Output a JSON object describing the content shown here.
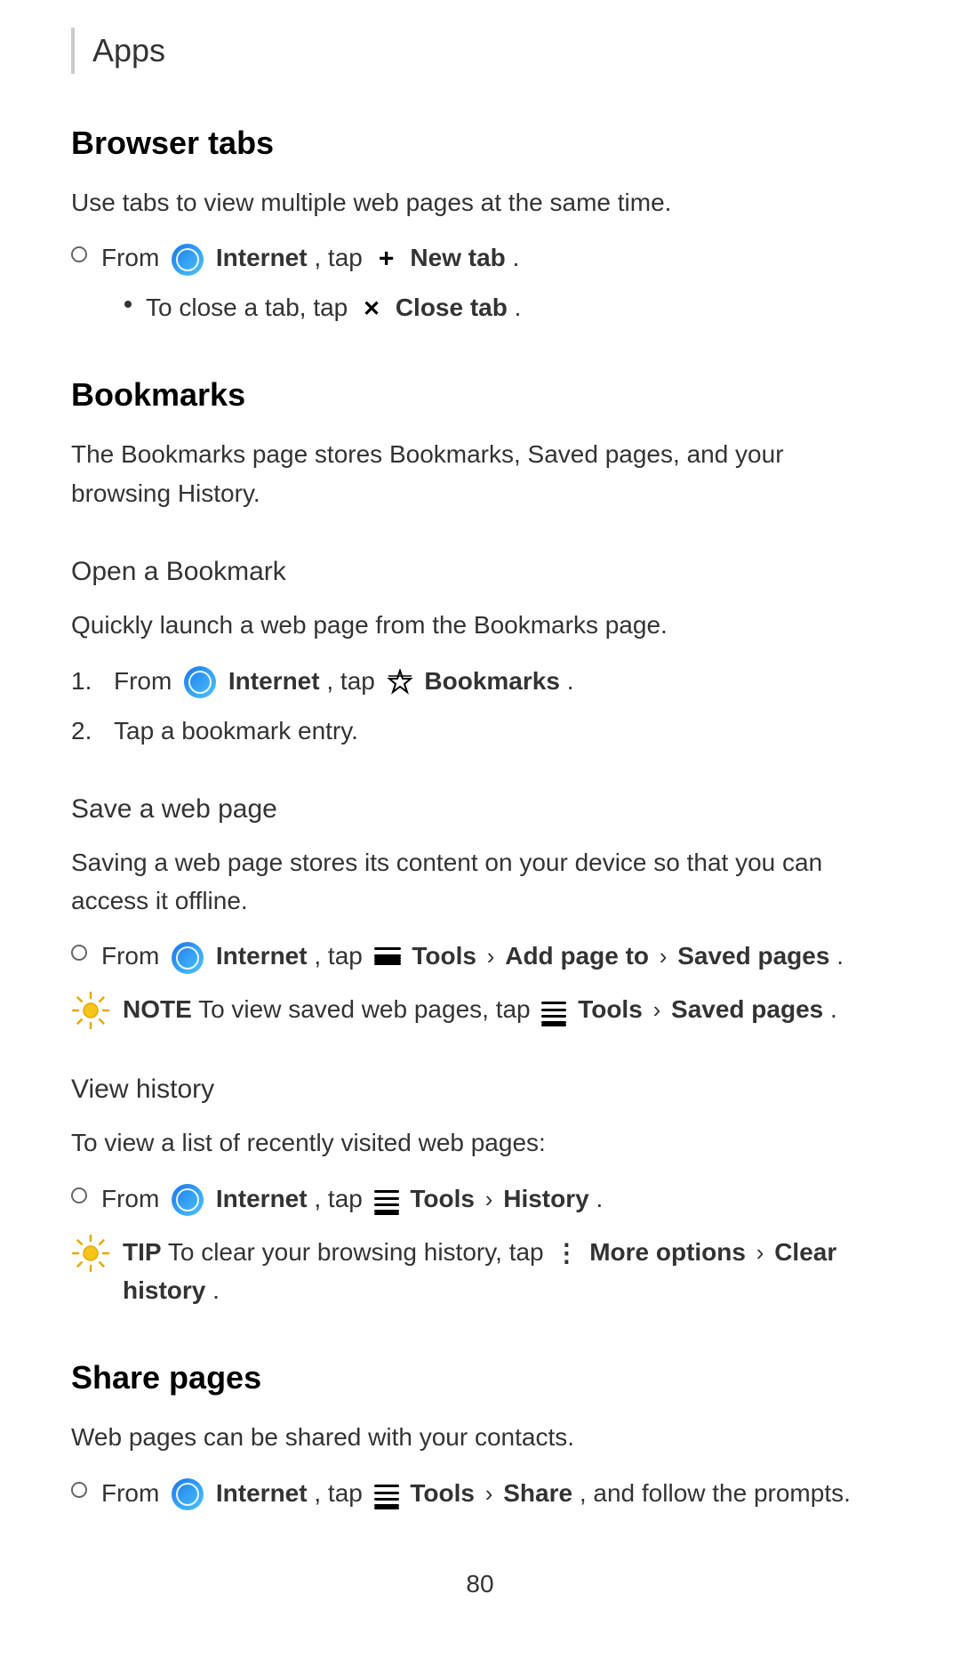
{
  "header": {
    "apps_label": "Apps",
    "border_present": true
  },
  "sections": {
    "browser_tabs": {
      "heading": "Browser tabs",
      "description": "Use tabs to view multiple web pages at the same time.",
      "items": [
        {
          "type": "circle-bullet",
          "text_before": "From",
          "app": "Internet",
          "tap_text": ", tap",
          "icon": "plus",
          "action": "New tab",
          "action_suffix": "."
        }
      ],
      "sub_items": [
        {
          "type": "dot-bullet",
          "text_before": "To close a tab, tap",
          "icon": "close",
          "action": "Close tab",
          "action_suffix": "."
        }
      ]
    },
    "bookmarks": {
      "heading": "Bookmarks",
      "description": "The Bookmarks page stores Bookmarks, Saved pages, and your browsing History.",
      "sub_sections": [
        {
          "heading": "Open a Bookmark",
          "description": "Quickly launch a web page from the Bookmarks page.",
          "numbered_items": [
            {
              "num": "1.",
              "text_before": "From",
              "app": "Internet",
              "tap_text": ", tap",
              "icon": "bookmarks",
              "action": "Bookmarks",
              "action_suffix": "."
            },
            {
              "num": "2.",
              "text": "Tap a bookmark entry."
            }
          ]
        },
        {
          "heading": "Save a web page",
          "description": "Saving a web page stores its content on your device so that you can access it offline.",
          "items": [
            {
              "type": "circle-bullet",
              "text_before": "From",
              "app": "Internet",
              "tap_text": ", tap",
              "icon": "tools",
              "action": "Tools",
              "chevron": ">",
              "action2": "Add page to",
              "chevron2": ">",
              "action3": "Saved pages",
              "action_suffix": "."
            }
          ],
          "notes": [
            {
              "type": "NOTE",
              "text_before": "NOTE",
              "content_before": "To view saved web pages, tap",
              "icon": "tools",
              "action": "Tools",
              "chevron": ">",
              "action2": "Saved pages",
              "action_suffix": "."
            }
          ]
        },
        {
          "heading": "View history",
          "description": "To view a list of recently visited web pages:",
          "items": [
            {
              "type": "circle-bullet",
              "text_before": "From",
              "app": "Internet",
              "tap_text": ", tap",
              "icon": "tools",
              "action": "Tools",
              "chevron": ">",
              "action2": "History",
              "action_suffix": "."
            }
          ],
          "notes": [
            {
              "type": "TIP",
              "text_before": "TIP",
              "content_before": "To clear your browsing history, tap",
              "icon": "more-options",
              "action": "More options",
              "chevron": ">",
              "action2": "Clear history",
              "action_suffix": "."
            }
          ]
        }
      ]
    },
    "share_pages": {
      "heading": "Share pages",
      "description": "Web pages can be shared with your contacts.",
      "items": [
        {
          "type": "circle-bullet",
          "text_before": "From",
          "app": "Internet",
          "tap_text": ", tap",
          "icon": "tools",
          "action": "Tools",
          "chevron": ">",
          "action2": "Share",
          "text_after": ", and follow the prompts",
          "action_suffix": "."
        }
      ]
    }
  },
  "footer": {
    "page_number": "80"
  }
}
